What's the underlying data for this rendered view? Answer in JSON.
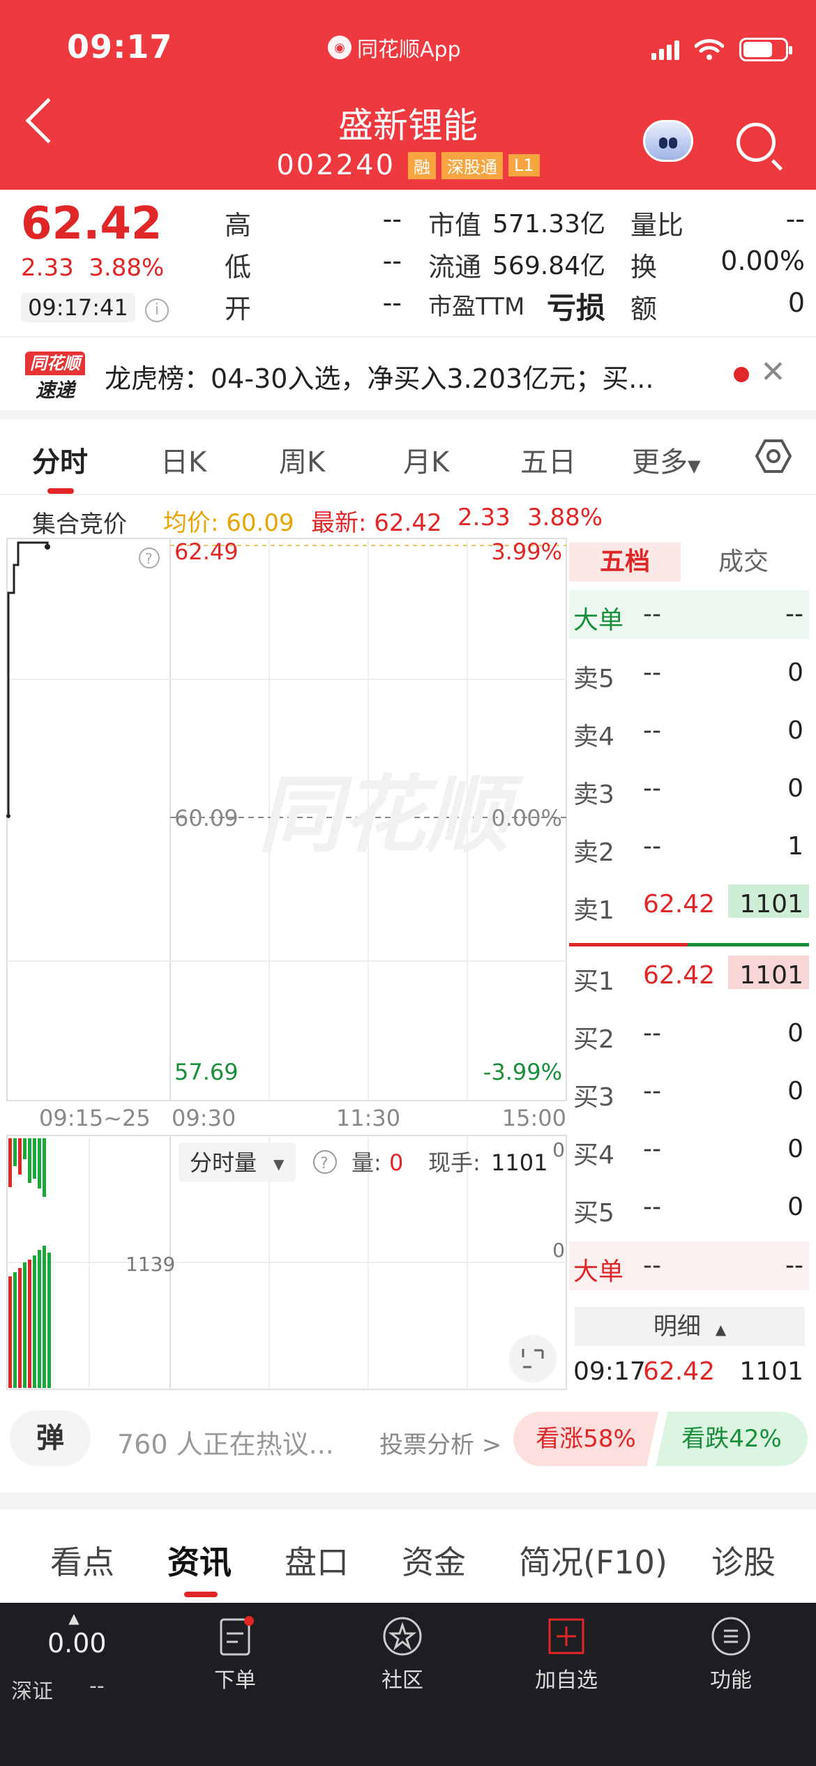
{
  "status_bar": {
    "time": "09:17",
    "app_name": "同花顺App"
  },
  "header": {
    "stock_name": "盛新锂能",
    "stock_code": "002240",
    "tags": [
      "融",
      "深股通",
      "L1"
    ]
  },
  "quote": {
    "price": "62.42",
    "change": "2.33",
    "change_pct": "3.88%",
    "time": "09:17:41",
    "fields": {
      "high_label": "高",
      "high_value": "--",
      "low_label": "低",
      "low_value": "--",
      "open_label": "开",
      "open_value": "--",
      "mcap_label": "市值",
      "mcap_value": "571.33亿",
      "float_label": "流通",
      "float_value": "569.84亿",
      "pe_label": "市盈TTM",
      "pe_value": "亏损",
      "vol_ratio_label": "量比",
      "vol_ratio_value": "--",
      "turnover_label": "换",
      "turnover_value": "0.00%",
      "amount_label": "额",
      "amount_value": "0"
    }
  },
  "news": {
    "logo_top": "同花顺",
    "logo_bottom": "速递",
    "text": "龙虎榜：04-30入选，净买入3.203亿元；买..."
  },
  "chart_tabs": [
    "分时",
    "日K",
    "周K",
    "月K",
    "五日",
    "更多"
  ],
  "avg_bar": {
    "auction_label": "集合竞价",
    "avg": "均价: 60.09",
    "latest": "最新: 62.42",
    "chg": "2.33",
    "pct": "3.88%"
  },
  "chart": {
    "top_price": "62.49",
    "top_pct": "3.99%",
    "mid_price": "60.09",
    "mid_pct": "0.00%",
    "bottom_price": "57.69",
    "bottom_pct": "-3.99%",
    "x_labels": [
      "09:15~25",
      "09:30",
      "11:30",
      "15:00"
    ],
    "volume_selector": "分时量",
    "volume_label": "量:",
    "volume_value": "0",
    "hand_label": "现手:",
    "hand_value": "1101",
    "auction_vol": "1139",
    "zero_top": "0",
    "zero_mid": "0",
    "watermark": "同花顺"
  },
  "order_book": {
    "tabs": [
      "五档",
      "成交"
    ],
    "big_label": "大单",
    "asks": [
      {
        "label": "卖5",
        "price": "--",
        "vol": "0"
      },
      {
        "label": "卖4",
        "price": "--",
        "vol": "0"
      },
      {
        "label": "卖3",
        "price": "--",
        "vol": "0"
      },
      {
        "label": "卖2",
        "price": "--",
        "vol": "1"
      },
      {
        "label": "卖1",
        "price": "62.42",
        "vol": "1101"
      }
    ],
    "bids": [
      {
        "label": "买1",
        "price": "62.42",
        "vol": "1101"
      },
      {
        "label": "买2",
        "price": "--",
        "vol": "0"
      },
      {
        "label": "买3",
        "price": "--",
        "vol": "0"
      },
      {
        "label": "买4",
        "price": "--",
        "vol": "0"
      },
      {
        "label": "买5",
        "price": "--",
        "vol": "0"
      }
    ],
    "dash": "--",
    "detail_label": "明细",
    "detail_row": {
      "time": "09:17",
      "price": "62.42",
      "vol": "1101"
    }
  },
  "sentiment": {
    "danmu": "弹",
    "hot": "760 人正在热议...",
    "vote": "投票分析 >",
    "bull": "看涨58%",
    "bear": "看跌42%"
  },
  "section_tabs": [
    "看点",
    "资讯",
    "盘口",
    "资金",
    "简况(F10)",
    "诊股"
  ],
  "bottom_bar": {
    "index_value": "0.00",
    "index_name": "深证",
    "index_change": "--",
    "items": [
      "下单",
      "社区",
      "加自选",
      "功能"
    ]
  },
  "colors": {
    "brand_red": "#ee3a3f",
    "up": "#e02626",
    "down": "#1a8f3a",
    "avg": "#e8a400"
  }
}
